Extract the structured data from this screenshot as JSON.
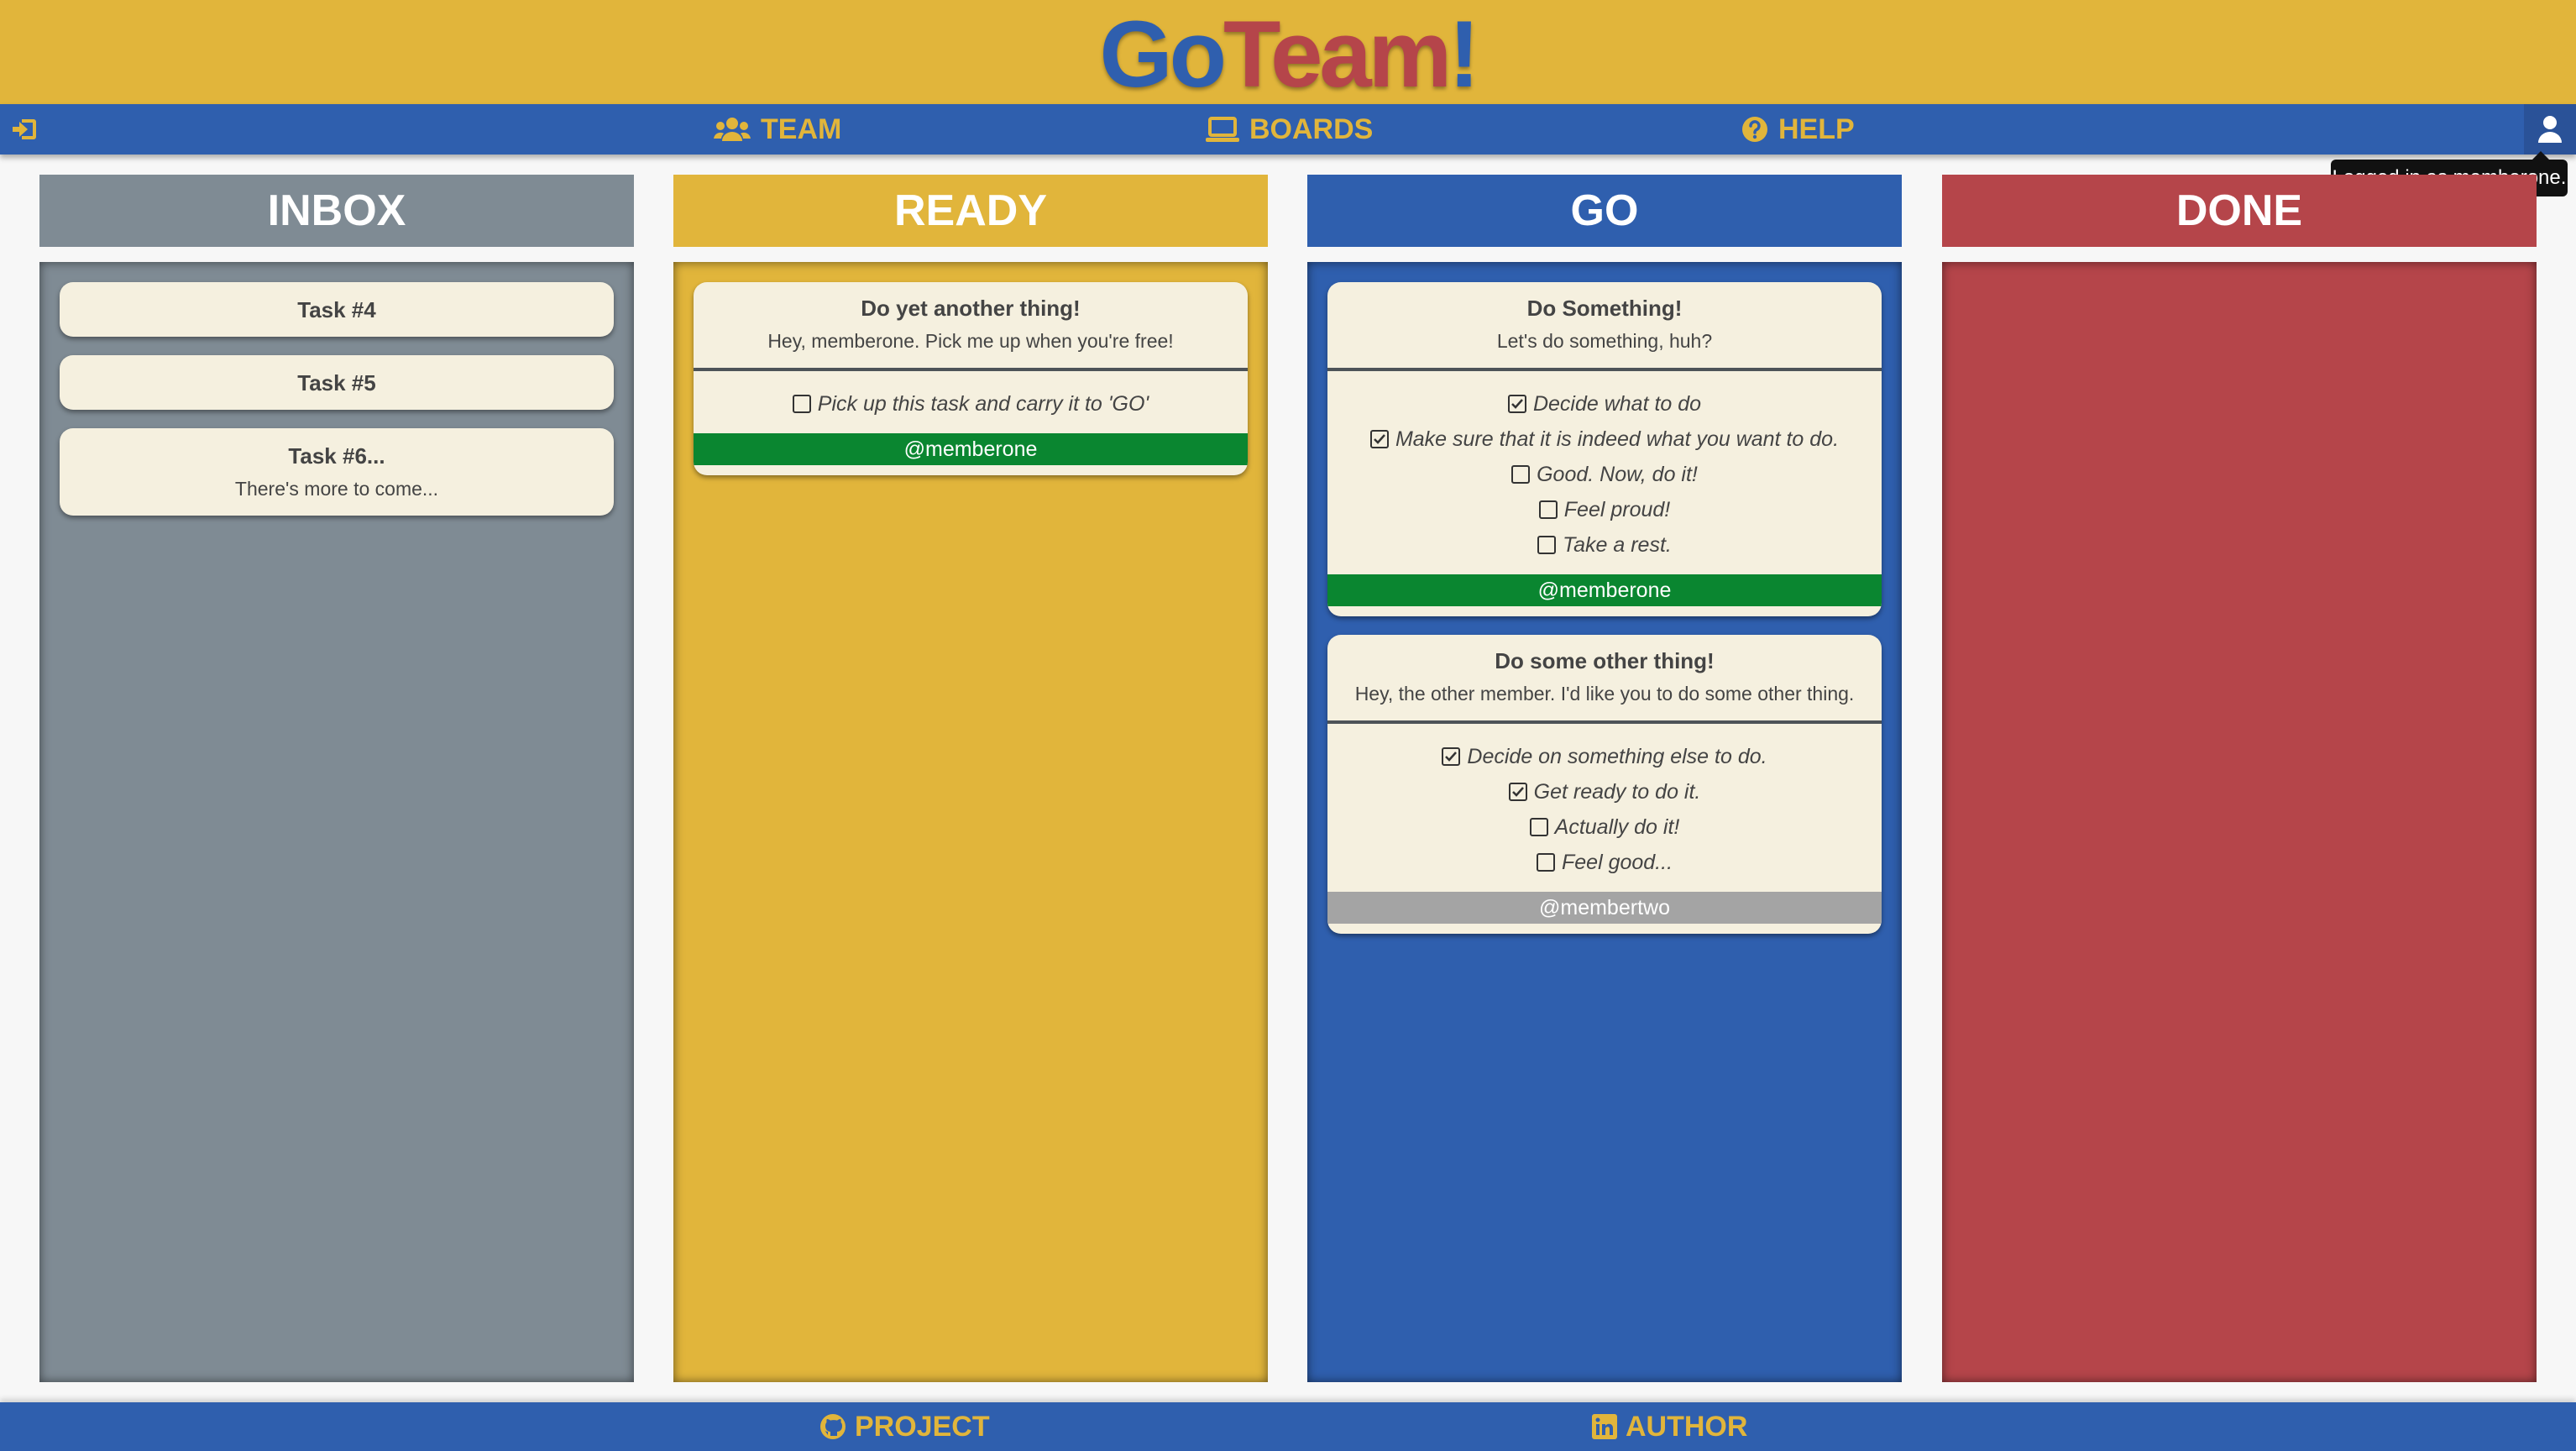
{
  "logo": {
    "go": "Go",
    "team": "Team",
    "bang": "!"
  },
  "nav": {
    "team": "TEAM",
    "boards": "BOARDS",
    "help": "HELP"
  },
  "tooltip": "Logged in as memberone.",
  "columns": {
    "inbox": "INBOX",
    "ready": "READY",
    "go": "GO",
    "done": "DONE"
  },
  "inbox": [
    {
      "title": "Task #4"
    },
    {
      "title": "Task #5"
    },
    {
      "title": "Task #6...",
      "desc": "There's more to come..."
    }
  ],
  "ready": [
    {
      "title": "Do yet another thing!",
      "desc": "Hey, memberone. Pick me up when you're free!",
      "checks": [
        {
          "text": "Pick up this task and carry it to 'GO'",
          "checked": false
        }
      ],
      "assignee": "@memberone"
    }
  ],
  "go": [
    {
      "title": "Do Something!",
      "desc": "Let's do something, huh?",
      "checks": [
        {
          "text": "Decide what to do",
          "checked": true
        },
        {
          "text": "Make sure that it is indeed what you want to do.",
          "checked": true
        },
        {
          "text": "Good. Now, do it!",
          "checked": false
        },
        {
          "text": "Feel proud!",
          "checked": false
        },
        {
          "text": "Take a rest.",
          "checked": false
        }
      ],
      "assignee": "@memberone"
    },
    {
      "title": "Do some other thing!",
      "desc": "Hey, the other member. I'd like you to do some other thing.",
      "checks": [
        {
          "text": "Decide on something else to do.",
          "checked": true
        },
        {
          "text": "Get ready to do it.",
          "checked": true
        },
        {
          "text": "Actually do it!",
          "checked": false
        },
        {
          "text": "Feel good...",
          "checked": false
        }
      ],
      "assignee": "@membertwo"
    }
  ],
  "footer": {
    "project": "PROJECT",
    "author": "AUTHOR"
  },
  "colors": {
    "yellow": "#e1b53b",
    "blue": "#2f5fae",
    "red": "#b5454a",
    "gray": "#7f8b94",
    "card": "#f5f0df",
    "assignee_active": "#0a8630",
    "assignee_other": "#a4a4a4"
  },
  "icons": {
    "logout": "sign-out-icon",
    "team": "users-icon",
    "boards": "laptop-icon",
    "help": "question-circle-icon",
    "user": "user-icon",
    "project": "github-icon",
    "author": "linkedin-icon"
  }
}
